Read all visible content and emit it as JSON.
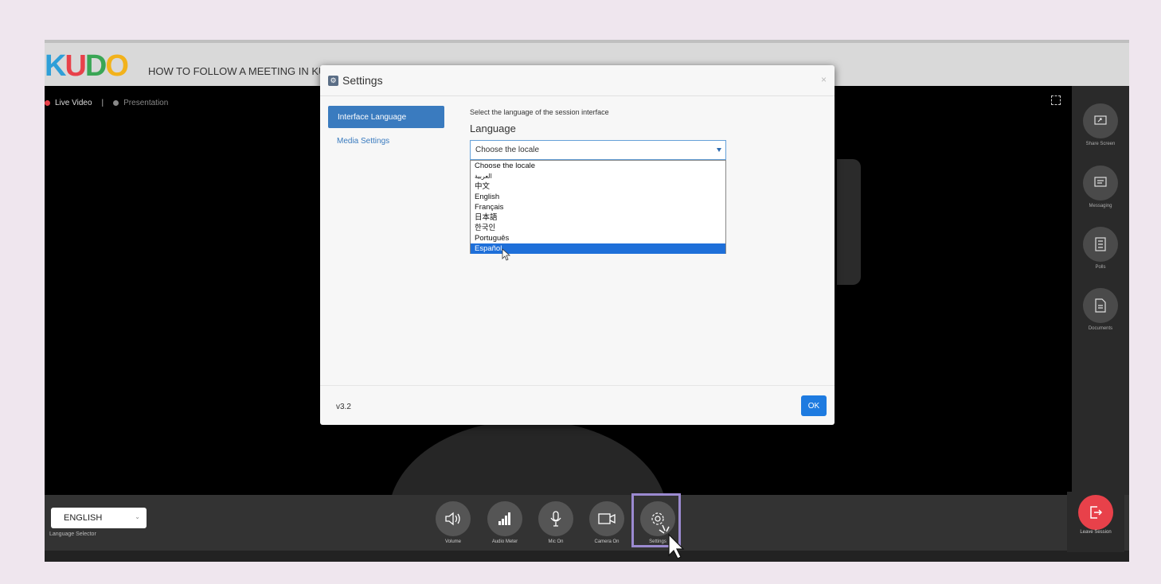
{
  "app": {
    "logo_letters": [
      "K",
      "U",
      "D",
      "O"
    ],
    "logo_colors": [
      "#e8414a",
      "#2e9fd8",
      "#f2b21b",
      "#3aa655"
    ],
    "page_title": "HOW TO FOLLOW A MEETING IN KUDO"
  },
  "video": {
    "tab_live": "Live Video",
    "separator": "|",
    "tab_presentation": "Presentation"
  },
  "right_panel": [
    {
      "label": "Share Screen",
      "icon": "share-screen-icon"
    },
    {
      "label": "Messaging",
      "icon": "messaging-icon"
    },
    {
      "label": "Polls",
      "icon": "polls-icon"
    },
    {
      "label": "Documents",
      "icon": "documents-icon"
    }
  ],
  "bottom_bar": {
    "language_value": "ENGLISH",
    "language_caption": "Language Selector",
    "controls": [
      {
        "label": "Volume",
        "icon": "volume-icon"
      },
      {
        "label": "Audio Meter",
        "icon": "audio-meter-icon"
      },
      {
        "label": "Mic On",
        "icon": "mic-icon"
      },
      {
        "label": "Camera On",
        "icon": "camera-icon"
      },
      {
        "label": "Settings",
        "icon": "settings-gear-icon"
      }
    ],
    "leave_label": "Leave Session"
  },
  "dialog": {
    "title": "Settings",
    "close": "×",
    "nav": [
      "Interface Language",
      "Media Settings"
    ],
    "description": "Select the language of the session interface",
    "heading": "Language",
    "select_value": "Choose the locale",
    "options": [
      "Choose the locale",
      "العربية",
      "中文",
      "English",
      "Français",
      "日本語",
      "한국인",
      "Português",
      "Español"
    ],
    "selected_option": "Español",
    "version": "v3.2",
    "ok": "OK"
  }
}
